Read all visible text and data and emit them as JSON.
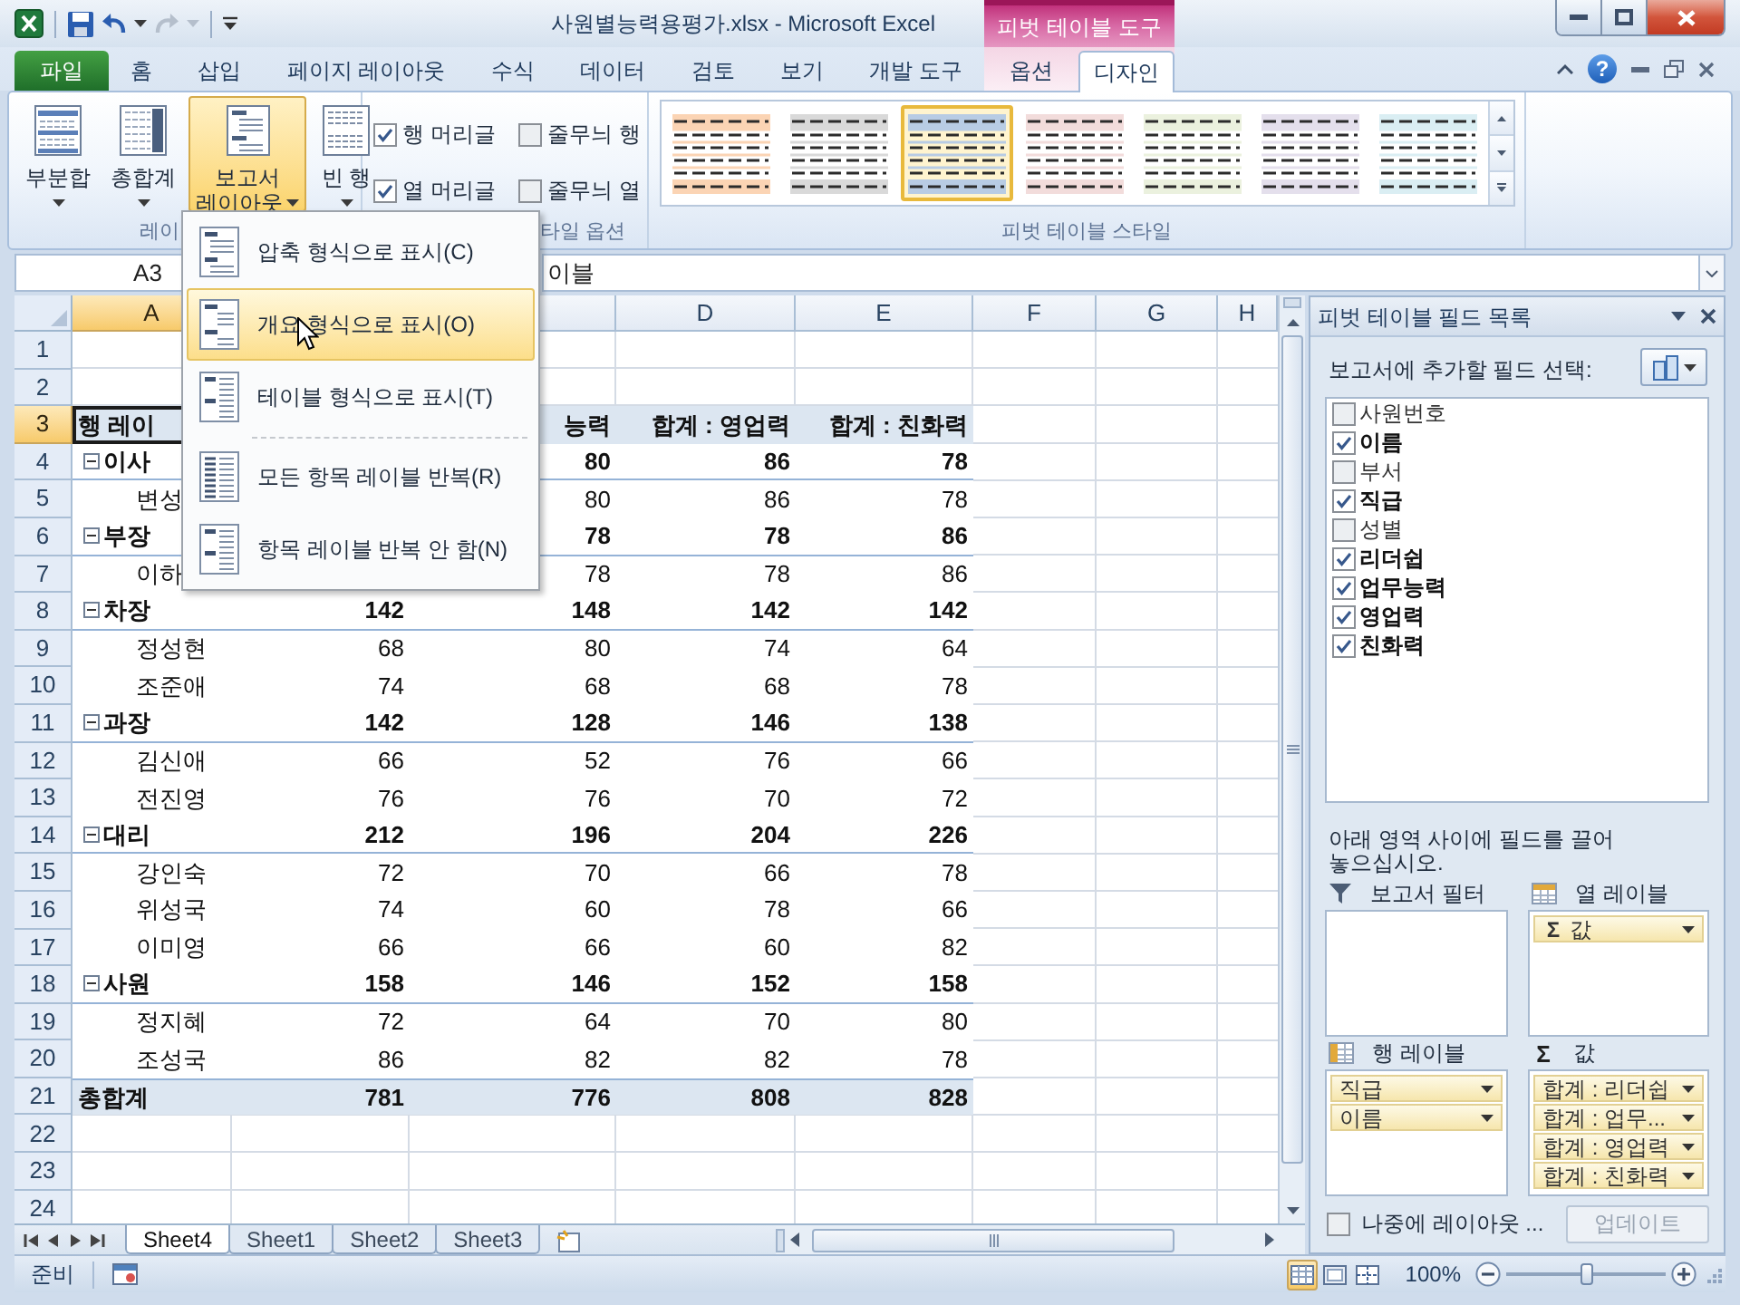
{
  "title_bar": {
    "quick_access": [
      {
        "disabled": false
      },
      {
        "disabled": false
      },
      {
        "disabled": true
      }
    ],
    "title": "사원별능력용평가.xlsx - Microsoft Excel",
    "context_group": "피벗 테이블 도구"
  },
  "tabs": [
    {
      "label": "파일",
      "kind": "file",
      "selected": false
    },
    {
      "label": "홈",
      "kind": "standard",
      "selected": false
    },
    {
      "label": "삽입",
      "kind": "standard",
      "selected": false
    },
    {
      "label": "페이지 레이아웃",
      "kind": "standard",
      "selected": false
    },
    {
      "label": "수식",
      "kind": "standard",
      "selected": false
    },
    {
      "label": "데이터",
      "kind": "standard",
      "selected": false
    },
    {
      "label": "검토",
      "kind": "standard",
      "selected": false
    },
    {
      "label": "보기",
      "kind": "standard",
      "selected": false
    },
    {
      "label": "개발 도구",
      "kind": "standard",
      "selected": false
    },
    {
      "label": "옵션",
      "kind": "contextual",
      "selected": false
    },
    {
      "label": "디자인",
      "kind": "contextual",
      "selected": true
    }
  ],
  "ribbon_controls": {
    "help": "?"
  },
  "ribbon": {
    "groups": [
      {
        "kind": "buttons",
        "label": "레이",
        "buttons": [
          {
            "lines": [
              "부분합"
            ],
            "pressed": false
          },
          {
            "lines": [
              "총합계"
            ],
            "pressed": false
          },
          {
            "lines": [
              "보고서",
              "레이아웃"
            ],
            "pressed": true
          },
          {
            "lines": [
              "빈 행"
            ],
            "pressed": false
          }
        ]
      },
      {
        "kind": "checkboxes",
        "label": "타일 옵션",
        "options": [
          {
            "label": "행 머리글",
            "checked": true
          },
          {
            "label": "줄무늬 행",
            "checked": false
          },
          {
            "label": "열 머리글",
            "checked": true
          },
          {
            "label": "줄무늬 열",
            "checked": false
          }
        ]
      },
      {
        "kind": "gallery",
        "label": "피벗 테이블 스타일",
        "styles": [
          {
            "color": "#fbd4b4",
            "selected": false
          },
          {
            "color": "#d9d9d9",
            "selected": false
          },
          {
            "color": "#b8cce4",
            "selected": true
          },
          {
            "color": "#f2dcdb",
            "selected": false
          },
          {
            "color": "#ebf1de",
            "selected": false
          },
          {
            "color": "#e4dfec",
            "selected": false
          },
          {
            "color": "#daeef3",
            "selected": false
          }
        ]
      }
    ]
  },
  "formula_bar": {
    "cell": "A3",
    "formula": "이블"
  },
  "layout_menu": {
    "items": [
      {
        "kind": "option",
        "label": "압축 형식으로 표시(C)",
        "highlighted": false
      },
      {
        "kind": "option",
        "label": "개요 형식으로 표시(O)",
        "highlighted": true
      },
      {
        "kind": "option",
        "label": "테이블 형식으로 표시(T)",
        "highlighted": false
      },
      {
        "kind": "separator"
      },
      {
        "kind": "option",
        "label": "모든 항목 레이블 반복(R)",
        "highlighted": false
      },
      {
        "kind": "option",
        "label": "항목 레이블 반복 안 함(N)",
        "highlighted": false
      }
    ]
  },
  "sheet": {
    "columns": [
      {
        "label": "A",
        "selected": true
      },
      {},
      {
        "selected": false
      },
      {
        "label": "D",
        "selected": false
      },
      {
        "label": "E",
        "selected": false
      },
      {
        "label": "F",
        "selected": false
      },
      {
        "label": "G",
        "selected": false
      },
      {
        "label": "H",
        "selected": false
      }
    ],
    "rows": [
      {
        "number": "1",
        "selected": false
      },
      {
        "number": "2",
        "selected": false
      },
      {
        "number": "3",
        "selected": true,
        "kind": "header",
        "label": "행 레이",
        "values": [
          "능력",
          "합계 : 영업력",
          "합계 : 친화력"
        ]
      },
      {
        "number": "4",
        "selected": false,
        "kind": "group",
        "expanded": true,
        "label": "이사",
        "values": [
          "80",
          "86",
          "78"
        ]
      },
      {
        "number": "5",
        "selected": false,
        "kind": "item",
        "label": "변성",
        "values": [
          "80",
          "86",
          "78"
        ]
      },
      {
        "number": "6",
        "selected": false,
        "kind": "group",
        "expanded": true,
        "label": "부장",
        "values": [
          "78",
          "78",
          "86"
        ]
      },
      {
        "number": "7",
        "selected": false,
        "kind": "item",
        "label": "이하",
        "values": [
          "78",
          "78",
          "86"
        ]
      },
      {
        "number": "8",
        "selected": false,
        "kind": "group",
        "expanded": true,
        "label": "차장",
        "values": [
          "142",
          "148",
          "142",
          "142"
        ]
      },
      {
        "number": "9",
        "selected": false,
        "kind": "item",
        "label": "정성현",
        "values": [
          "68",
          "80",
          "74",
          "64"
        ]
      },
      {
        "number": "10",
        "selected": false,
        "kind": "item",
        "label": "조준애",
        "values": [
          "74",
          "68",
          "68",
          "78"
        ]
      },
      {
        "number": "11",
        "selected": false,
        "kind": "group",
        "expanded": true,
        "label": "과장",
        "values": [
          "142",
          "128",
          "146",
          "138"
        ]
      },
      {
        "number": "12",
        "selected": false,
        "kind": "item",
        "label": "김신애",
        "values": [
          "66",
          "52",
          "76",
          "66"
        ]
      },
      {
        "number": "13",
        "selected": false,
        "kind": "item",
        "label": "전진영",
        "values": [
          "76",
          "76",
          "70",
          "72"
        ]
      },
      {
        "number": "14",
        "selected": false,
        "kind": "group",
        "expanded": true,
        "label": "대리",
        "values": [
          "212",
          "196",
          "204",
          "226"
        ]
      },
      {
        "number": "15",
        "selected": false,
        "kind": "item",
        "label": "강인숙",
        "values": [
          "72",
          "70",
          "66",
          "78"
        ]
      },
      {
        "number": "16",
        "selected": false,
        "kind": "item",
        "label": "위성국",
        "values": [
          "74",
          "60",
          "78",
          "66"
        ]
      },
      {
        "number": "17",
        "selected": false,
        "kind": "item",
        "label": "이미영",
        "values": [
          "66",
          "66",
          "60",
          "82"
        ]
      },
      {
        "number": "18",
        "selected": false,
        "kind": "group",
        "expanded": true,
        "label": "사원",
        "values": [
          "158",
          "146",
          "152",
          "158"
        ]
      },
      {
        "number": "19",
        "selected": false,
        "kind": "item",
        "label": "정지혜",
        "values": [
          "72",
          "64",
          "70",
          "80"
        ]
      },
      {
        "number": "20",
        "selected": false,
        "kind": "item",
        "label": "조성국",
        "values": [
          "86",
          "82",
          "82",
          "78"
        ]
      },
      {
        "number": "21",
        "selected": false,
        "kind": "total",
        "label": "총합계",
        "values": [
          "781",
          "776",
          "808",
          "828"
        ]
      },
      {
        "number": "22",
        "selected": false
      },
      {
        "number": "23",
        "selected": false
      },
      {
        "number": "24",
        "selected": false
      }
    ]
  },
  "sheet_tabs": {
    "tabs": [
      {
        "label": "Sheet4",
        "selected": true
      },
      {
        "label": "Sheet1",
        "selected": false
      },
      {
        "label": "Sheet2",
        "selected": false
      },
      {
        "label": "Sheet3",
        "selected": false
      }
    ]
  },
  "field_list": {
    "title": "피벗 테이블 필드 목록",
    "prompt": "보고서에 추가할 필드 선택:",
    "fields": [
      {
        "label": "사원번호",
        "checked": false
      },
      {
        "label": "이름",
        "checked": true
      },
      {
        "label": "부서",
        "checked": false
      },
      {
        "label": "직급",
        "checked": true
      },
      {
        "label": "성별",
        "checked": false
      },
      {
        "label": "리더쉽",
        "checked": true
      },
      {
        "label": "업무능력",
        "checked": true
      },
      {
        "label": "영업력",
        "checked": true
      },
      {
        "label": "친화력",
        "checked": true
      }
    ],
    "hint": "아래 영역 사이에 필드를 끌어 놓으십시오.",
    "areas": [
      {
        "kind": "filter",
        "label": "보고서 필터"
      },
      {
        "kind": "columns",
        "label": "열 레이블",
        "items": [
          {
            "kind": "values",
            "symbol": "Σ",
            "label": "값"
          }
        ]
      },
      {
        "kind": "rows",
        "label": "행 레이블",
        "items": [
          {
            "kind": "field",
            "label": "직급"
          },
          {
            "kind": "field",
            "label": "이름"
          }
        ]
      },
      {
        "kind": "values",
        "symbol": "Σ",
        "label": "값",
        "items": [
          {
            "kind": "field",
            "label": "합계 : 리더쉽"
          },
          {
            "kind": "field",
            "label": "합계 : 업무..."
          },
          {
            "kind": "field",
            "label": "합계 : 영업력"
          },
          {
            "kind": "field",
            "label": "합계 : 친화력"
          }
        ]
      }
    ],
    "defer_update": {
      "label": "나중에 레이아웃 ...",
      "checked": false
    },
    "update_button": {
      "label": "업데이트",
      "disabled": true
    }
  },
  "status_bar": {
    "status": "준비",
    "views": [
      {
        "selected": true
      },
      {
        "selected": false
      },
      {
        "selected": false
      }
    ],
    "zoom": {
      "reading": "100%",
      "level": 0.5
    }
  }
}
